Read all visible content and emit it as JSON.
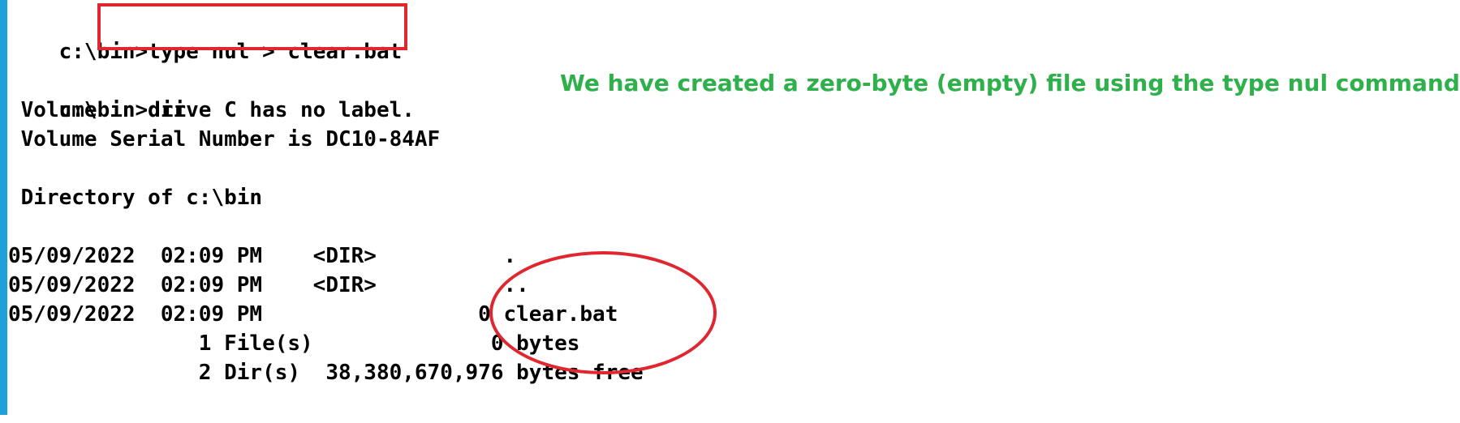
{
  "terminal": {
    "command1": {
      "prompt": "c:\\bin>",
      "command": "type nul > clear.bat"
    },
    "command2": {
      "prompt": "c:\\bin>",
      "command": "dir"
    },
    "volume_label": " Volume in drive C has no label.",
    "volume_serial": " Volume Serial Number is DC10-84AF",
    "directory_of": " Directory of c:\\bin",
    "entries": [
      {
        "text": "05/09/2022  02:09 PM    <DIR>          ."
      },
      {
        "text": "05/09/2022  02:09 PM    <DIR>          .."
      },
      {
        "text": "05/09/2022  02:09 PM                 0 clear.bat"
      }
    ],
    "summary_files": "               1 File(s)              0 bytes",
    "summary_dirs": "               2 Dir(s)  38,380,670,976 bytes free"
  },
  "annotation": {
    "text": "We have created a zero-byte (empty) file using the type nul command.",
    "color": "#2eb04a"
  },
  "highlight_color": "#e0262e",
  "accent_bar_color": "#1ea0db"
}
